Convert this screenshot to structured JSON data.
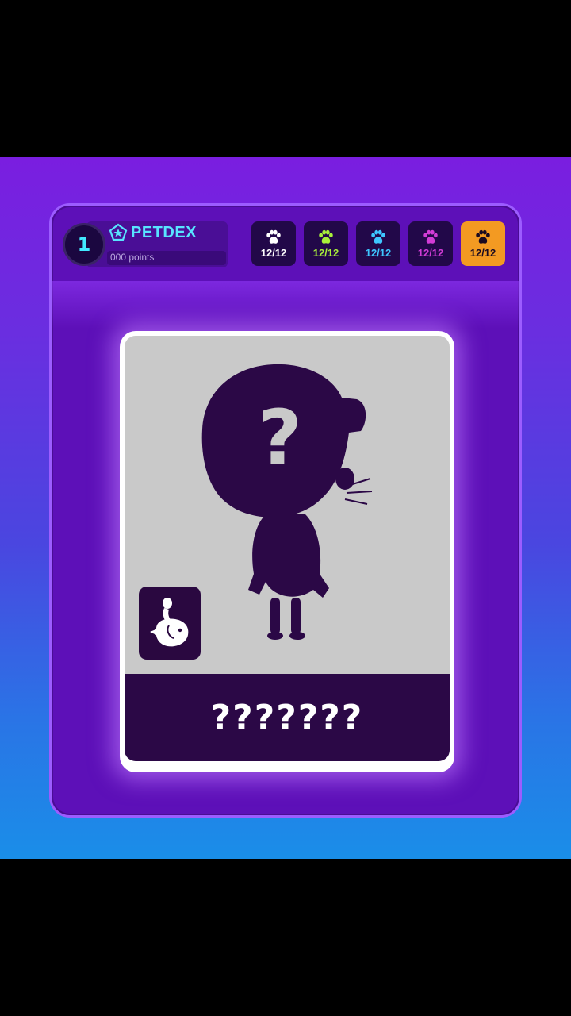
{
  "header": {
    "level": "1",
    "title": "PETDEX",
    "points": "000 points"
  },
  "collections": [
    {
      "count": "12/12",
      "color": "#ffffff",
      "active": false
    },
    {
      "count": "12/12",
      "color": "#a8f03a",
      "active": false
    },
    {
      "count": "12/12",
      "color": "#3ec6ff",
      "active": false
    },
    {
      "count": "12/12",
      "color": "#d23cd6",
      "active": false
    },
    {
      "count": "12/12",
      "color": "#1a0a20",
      "active": true
    }
  ],
  "card": {
    "name": "???????",
    "mystery_mark": "?",
    "type_icon": "ghost-rider-icon"
  },
  "colors": {
    "panel": "#5d10b8",
    "accent_cyan": "#58e4ff",
    "active_tile": "#f39a22",
    "silhouette": "#2b0846"
  }
}
